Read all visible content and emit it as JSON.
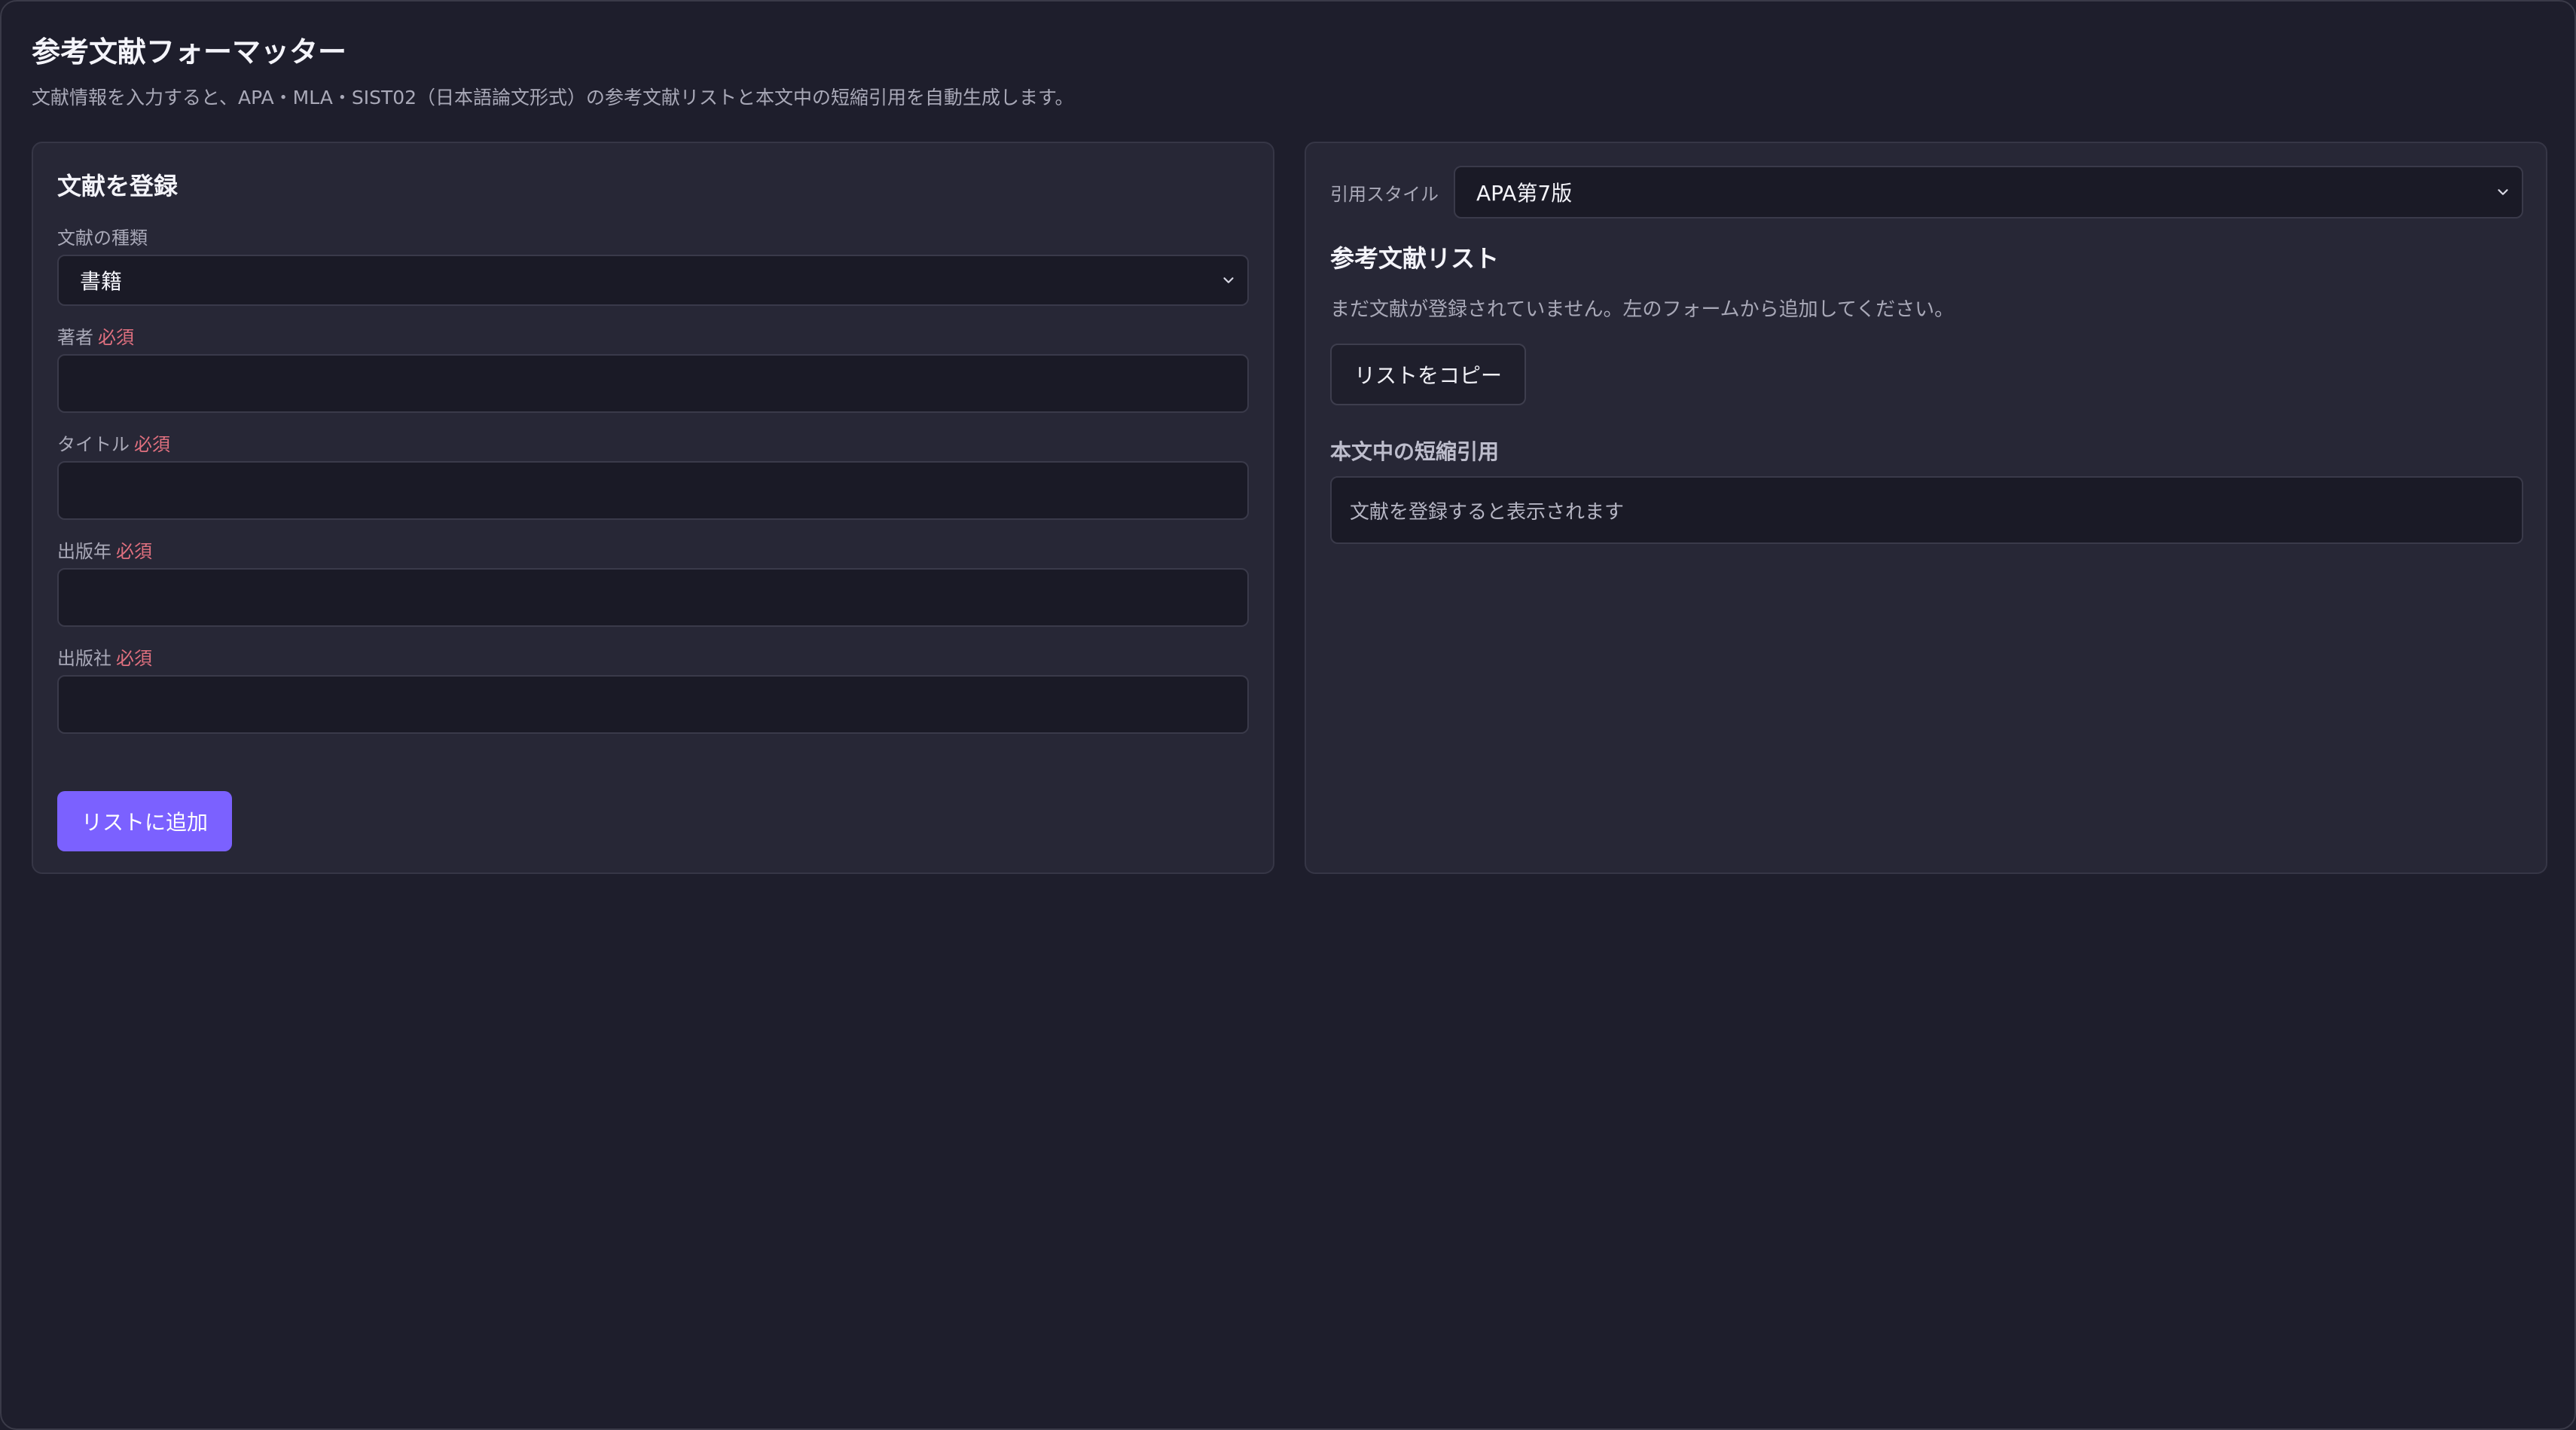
{
  "colors": {
    "background": "#1e1e2c",
    "card": "#272736",
    "input": "#1a1a26",
    "accent": "#7b61ff",
    "required": "#e0707f"
  },
  "header": {
    "title": "参考文献フォーマッター",
    "subtitle": "文献情報を入力すると、APA・MLA・SIST02（日本語論文形式）の参考文献リストと本文中の短縮引用を自動生成します。"
  },
  "form": {
    "heading": "文献を登録",
    "type_label": "文献の種類",
    "type_value": "書籍",
    "fields": [
      {
        "label": "著者",
        "required": "必須",
        "value": ""
      },
      {
        "label": "タイトル",
        "required": "必須",
        "value": ""
      },
      {
        "label": "出版年",
        "required": "必須",
        "value": ""
      },
      {
        "label": "出版社",
        "required": "必須",
        "value": ""
      }
    ],
    "add_button": "リストに追加"
  },
  "output": {
    "style_label": "引用スタイル",
    "style_value": "APA第7版",
    "list_heading": "参考文献リスト",
    "empty_message": "まだ文献が登録されていません。左のフォームから追加してください。",
    "copy_button": "リストをコピー",
    "intext_heading": "本文中の短縮引用",
    "intext_placeholder": "文献を登録すると表示されます"
  },
  "icons": {
    "select_chevron": "chevron-down-icon"
  }
}
